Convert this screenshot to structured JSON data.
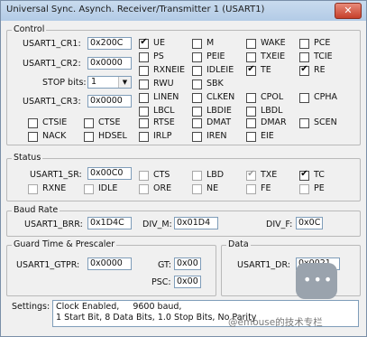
{
  "window": {
    "title": "Universal Sync. Asynch. Receiver/Transmitter 1 (USART1)",
    "close_glyph": "✕"
  },
  "control": {
    "title": "Control",
    "cr1_label": "USART1_CR1:",
    "cr1_value": "0x200C",
    "cr2_label": "USART1_CR2:",
    "cr2_value": "0x0000",
    "stop_label": "STOP bits:",
    "stop_value": "1",
    "cr3_label": "USART1_CR3:",
    "cr3_value": "0x0000",
    "checkboxes": [
      {
        "label": "UE",
        "checked": true
      },
      {
        "label": "M",
        "checked": false
      },
      {
        "label": "WAKE",
        "checked": false
      },
      {
        "label": "PCE",
        "checked": false
      },
      {
        "label": "PS",
        "checked": false
      },
      {
        "label": "PEIE",
        "checked": false
      },
      {
        "label": "TXEIE",
        "checked": false
      },
      {
        "label": "TCIE",
        "checked": false
      },
      {
        "label": "RXNEIE",
        "checked": false
      },
      {
        "label": "IDLEIE",
        "checked": false
      },
      {
        "label": "TE",
        "checked": true
      },
      {
        "label": "RE",
        "checked": true
      },
      {
        "label": "RWU",
        "checked": false
      },
      {
        "label": "SBK",
        "checked": false
      },
      {
        "label": "LINEN",
        "checked": false
      },
      {
        "label": "CLKEN",
        "checked": false
      },
      {
        "label": "CPOL",
        "checked": false
      },
      {
        "label": "CPHA",
        "checked": false
      },
      {
        "label": "LBCL",
        "checked": false
      },
      {
        "label": "LBDIE",
        "checked": false
      },
      {
        "label": "LBDL",
        "checked": false
      },
      {
        "label": "CTSIE",
        "checked": false
      },
      {
        "label": "CTSE",
        "checked": false
      },
      {
        "label": "RTSE",
        "checked": false
      },
      {
        "label": "DMAT",
        "checked": false
      },
      {
        "label": "DMAR",
        "checked": false
      },
      {
        "label": "SCEN",
        "checked": false
      },
      {
        "label": "NACK",
        "checked": false
      },
      {
        "label": "HDSEL",
        "checked": false
      },
      {
        "label": "IRLP",
        "checked": false
      },
      {
        "label": "IREN",
        "checked": false
      },
      {
        "label": "EIE",
        "checked": false
      }
    ]
  },
  "status": {
    "title": "Status",
    "sr_label": "USART1_SR:",
    "sr_value": "0x00C0",
    "checkboxes": [
      {
        "label": "CTS",
        "checked": false
      },
      {
        "label": "LBD",
        "checked": false
      },
      {
        "label": "TXE",
        "checked": true
      },
      {
        "label": "TC",
        "checked": true
      },
      {
        "label": "RXNE",
        "checked": false
      },
      {
        "label": "IDLE",
        "checked": false
      },
      {
        "label": "ORE",
        "checked": false
      },
      {
        "label": "NE",
        "checked": false
      },
      {
        "label": "FE",
        "checked": false
      },
      {
        "label": "PE",
        "checked": false
      }
    ]
  },
  "baud": {
    "title": "Baud Rate",
    "brr_label": "USART1_BRR:",
    "brr_value": "0x1D4C",
    "divm_label": "DIV_M:",
    "divm_value": "0x01D4",
    "divf_label": "DIV_F:",
    "divf_value": "0x0C"
  },
  "guard": {
    "title": "Guard Time & Prescaler",
    "gtpr_label": "USART1_GTPR:",
    "gtpr_value": "0x0000",
    "gt_label": "GT:",
    "gt_value": "0x00",
    "psc_label": "PSC:",
    "psc_value": "0x00"
  },
  "data": {
    "title": "Data",
    "dr_label": "USART1_DR:",
    "dr_value": "0x0021"
  },
  "settings": {
    "label": "Settings:",
    "line1": "Clock Enabled,     9600 baud,",
    "line2": "1 Start Bit, 8 Data Bits, 1.0 Stop Bits, No Parity"
  },
  "watermark": "@emouse的技术专栏"
}
